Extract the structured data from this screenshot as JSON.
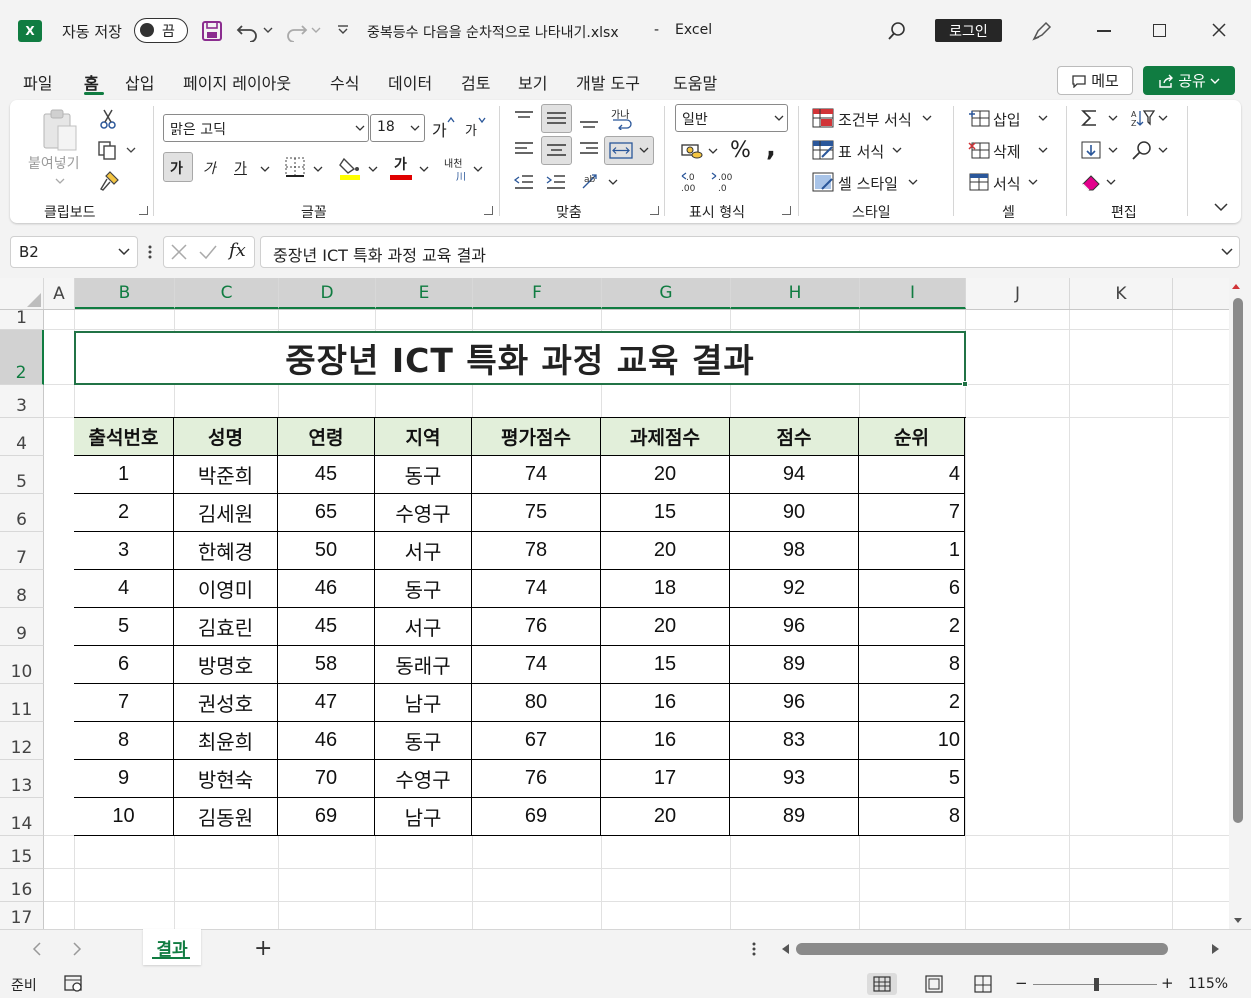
{
  "window": {
    "app_icon": "X",
    "autosave_label": "자동 저장",
    "autosave_state": "끔",
    "file_title": "중복등수 다음을 순차적으로 나타내기.xlsx",
    "separator": "-",
    "app_name": "Excel",
    "login_label": "로그인"
  },
  "menu": {
    "items": [
      "파일",
      "홈",
      "삽입",
      "페이지 레이아웃",
      "수식",
      "데이터",
      "검토",
      "보기",
      "개발 도구",
      "도움말"
    ],
    "active": "홈",
    "memo_label": "메모",
    "share_label": "공유"
  },
  "ribbon": {
    "clipboard": {
      "paste": "붙여넣기",
      "label": "클립보드"
    },
    "font": {
      "name": "맑은 고딕",
      "size": "18",
      "grow": "가",
      "shrink": "가",
      "bold": "가",
      "italic": "가",
      "underline": "가",
      "font_color_glyph": "가",
      "phonetic": "내천",
      "label": "글꼴"
    },
    "alignment": {
      "wrap": "가나",
      "label": "맞춤"
    },
    "number": {
      "format": "일반",
      "percent": "%",
      "comma": ",",
      "label": "표시 형식"
    },
    "styles": {
      "conditional": "조건부 서식",
      "table": "표 서식",
      "cell": "셀 스타일",
      "label": "스타일"
    },
    "cells": {
      "insert": "삽입",
      "delete": "삭제",
      "format": "서식",
      "label": "셀"
    },
    "editing": {
      "label": "편집"
    }
  },
  "formula_bar": {
    "name_box": "B2",
    "fx": "fx",
    "content": "중장년 ICT 특화 과정 교육 결과"
  },
  "grid": {
    "columns": [
      "A",
      "B",
      "C",
      "D",
      "E",
      "F",
      "G",
      "H",
      "I",
      "J",
      "K"
    ],
    "rows": [
      "1",
      "2",
      "3",
      "4",
      "5",
      "6",
      "7",
      "8",
      "9",
      "10",
      "11",
      "12",
      "13",
      "14",
      "15",
      "16",
      "17"
    ],
    "selected_column": "B",
    "selected_row": "2"
  },
  "sheet": {
    "title": "중장년 ICT 특화 과정 교육 결과",
    "headers": [
      "출석번호",
      "성명",
      "연령",
      "지역",
      "평가점수",
      "과제점수",
      "점수",
      "순위"
    ],
    "rows": [
      [
        "1",
        "박준희",
        "45",
        "동구",
        "74",
        "20",
        "94",
        "4"
      ],
      [
        "2",
        "김세원",
        "65",
        "수영구",
        "75",
        "15",
        "90",
        "7"
      ],
      [
        "3",
        "한혜경",
        "50",
        "서구",
        "78",
        "20",
        "98",
        "1"
      ],
      [
        "4",
        "이영미",
        "46",
        "동구",
        "74",
        "18",
        "92",
        "6"
      ],
      [
        "5",
        "김효린",
        "45",
        "서구",
        "76",
        "20",
        "96",
        "2"
      ],
      [
        "6",
        "방명호",
        "58",
        "동래구",
        "74",
        "15",
        "89",
        "8"
      ],
      [
        "7",
        "권성호",
        "47",
        "남구",
        "80",
        "16",
        "96",
        "2"
      ],
      [
        "8",
        "최윤희",
        "46",
        "동구",
        "67",
        "16",
        "83",
        "10"
      ],
      [
        "9",
        "방현숙",
        "70",
        "수영구",
        "76",
        "17",
        "93",
        "5"
      ],
      [
        "10",
        "김동원",
        "69",
        "남구",
        "69",
        "20",
        "89",
        "8"
      ]
    ]
  },
  "tabs": {
    "sheets": [
      "결과"
    ],
    "add": "+"
  },
  "status": {
    "ready": "준비",
    "zoom": "115%",
    "minus": "−",
    "plus": "+"
  },
  "colors": {
    "accent": "#107c41",
    "header_fill": "#e2efda",
    "selection": "#217346"
  }
}
